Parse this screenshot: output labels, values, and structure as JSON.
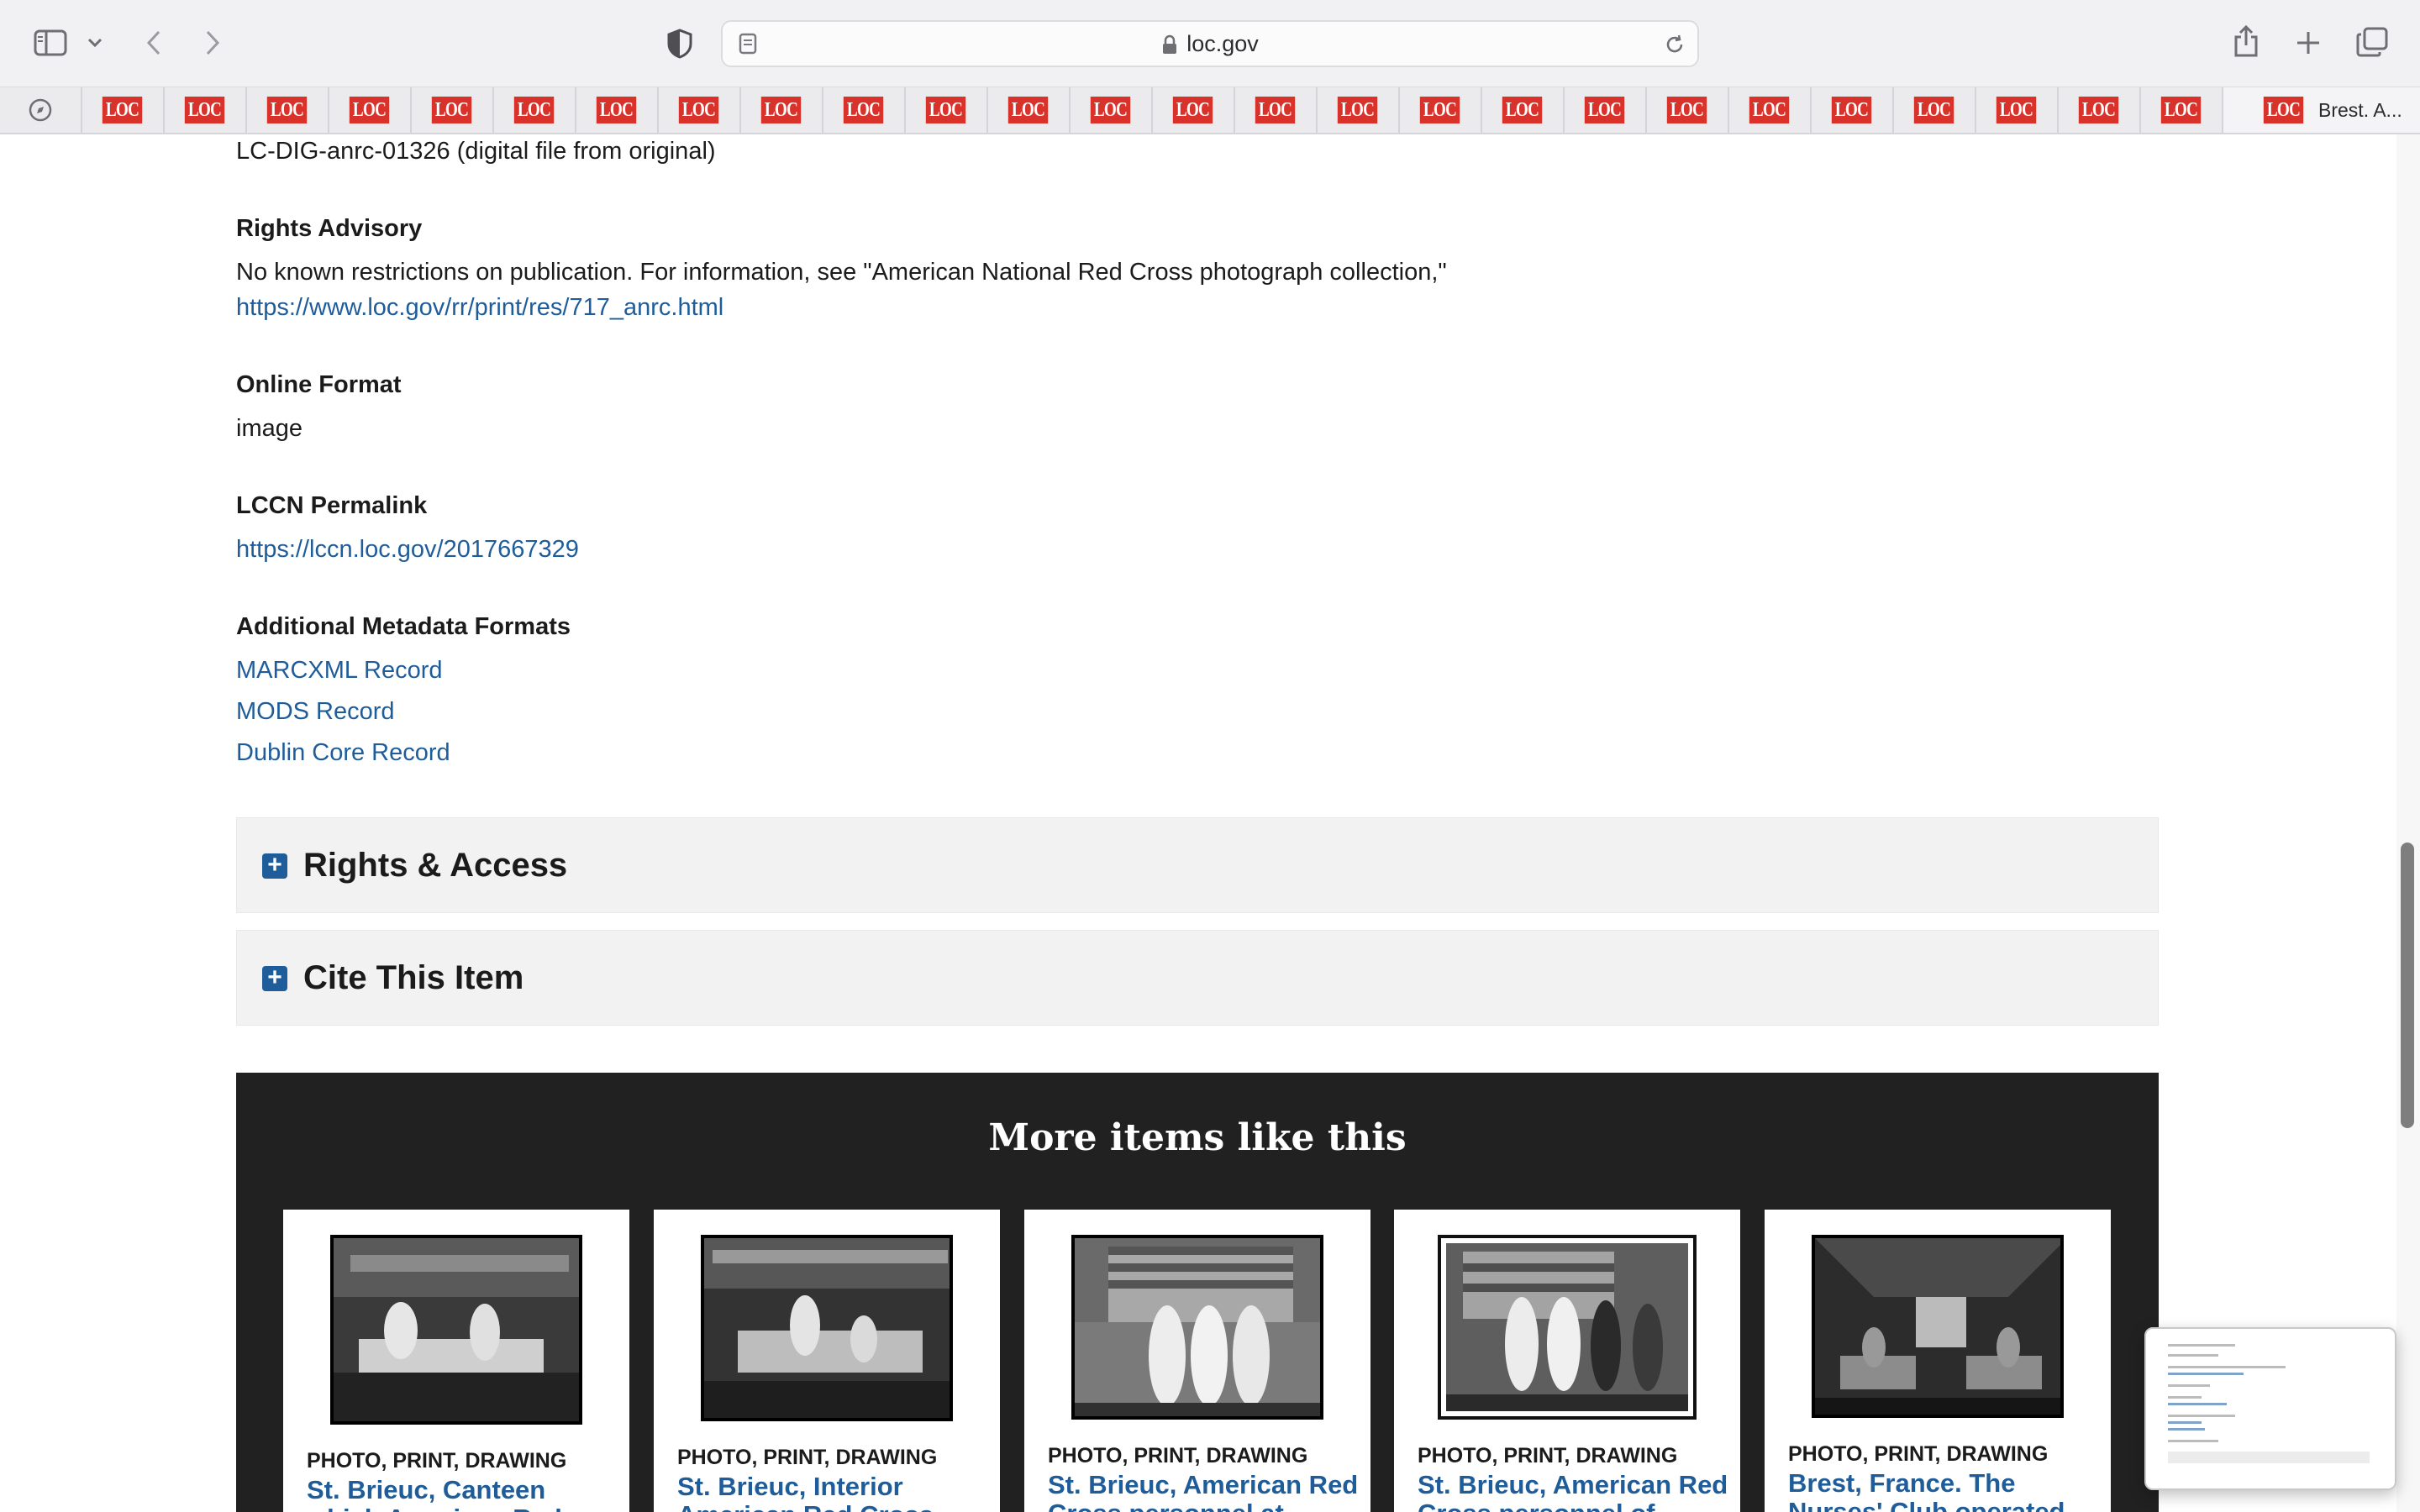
{
  "browser": {
    "url": "loc.gov",
    "bookmark_logo_text": "LOC",
    "bookmarks_count_visible": 26,
    "last_bookmark_label": "Brest. A...",
    "icons": [
      "sidebar-icon",
      "chevron-down-icon",
      "back-icon",
      "forward-icon",
      "shield-icon",
      "page-icon",
      "lock-icon",
      "reload-icon",
      "share-icon",
      "plus-icon",
      "tabs-overview-icon",
      "compass-icon"
    ]
  },
  "page": {
    "reproduction_number": "LC-DIG-anrc-01326 (digital file from original)",
    "rights_advisory": {
      "label": "Rights Advisory",
      "text": "No known restrictions on publication. For information, see \"American National Red Cross photograph collection,\"",
      "link": "https://www.loc.gov/rr/print/res/717_anrc.html"
    },
    "online_format": {
      "label": "Online Format",
      "value": "image"
    },
    "lccn_permalink": {
      "label": "LCCN Permalink",
      "link": "https://lccn.loc.gov/2017667329"
    },
    "metadata_formats": {
      "label": "Additional Metadata Formats",
      "links": [
        "MARCXML Record",
        "MODS Record",
        "Dublin Core Record"
      ]
    },
    "accordions": [
      {
        "label": "Rights & Access"
      },
      {
        "label": "Cite This Item"
      }
    ],
    "more_items": {
      "heading": "More items like this",
      "cards": [
        {
          "type": "PHOTO, PRINT, DRAWING",
          "title": "St. Brieuc, Canteen which American Red"
        },
        {
          "type": "PHOTO, PRINT, DRAWING",
          "title": "St. Brieuc, Interior American Red Cross"
        },
        {
          "type": "PHOTO, PRINT, DRAWING",
          "title": "St. Brieuc, American Red Cross personnel at"
        },
        {
          "type": "PHOTO, PRINT, DRAWING",
          "title": "St. Brieuc, American Red Cross personnel of"
        },
        {
          "type": "PHOTO, PRINT, DRAWING",
          "title": "Brest, France. The Nurses' Club operated by"
        }
      ]
    }
  },
  "colors": {
    "link": "#1f5d9a",
    "dark_panel": "#212121",
    "accordion_bg": "#f2f2f2",
    "loc_logo_red": "#d8322b"
  }
}
